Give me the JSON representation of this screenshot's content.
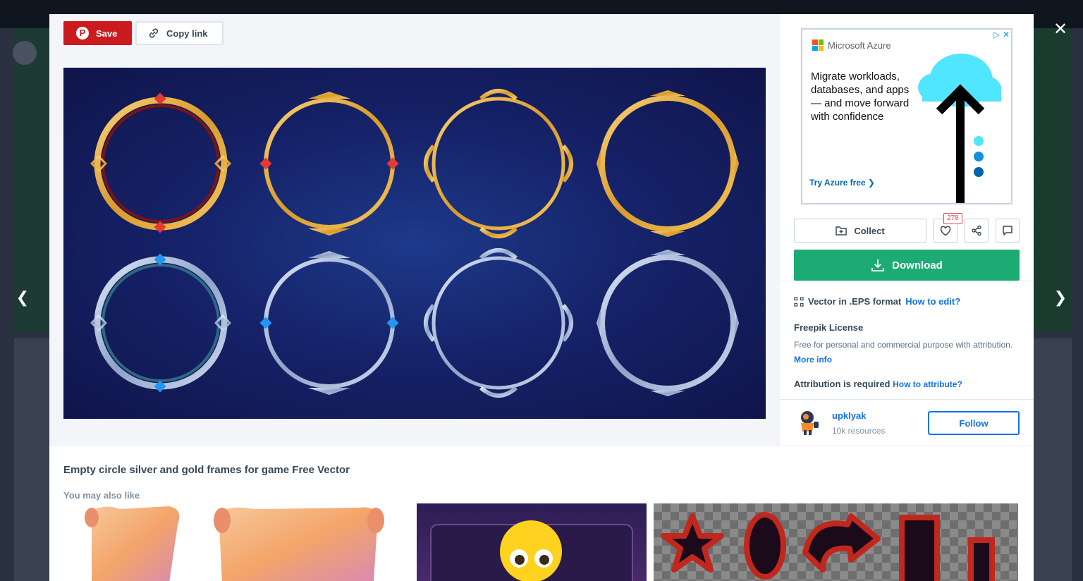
{
  "modal": {
    "save_label": "Save",
    "copy_label": "Copy link",
    "close_icon": "close-icon",
    "prev_icon": "chevron-left-icon",
    "next_icon": "chevron-right-icon"
  },
  "image": {
    "title": "Empty circle silver and gold frames for game Free Vector"
  },
  "ad": {
    "brand": "Microsoft Azure",
    "headline": "Migrate workloads, databases, and apps— and move forward with confidence",
    "cta": "Try Azure free ❯"
  },
  "actions": {
    "collect_label": "Collect",
    "like_count": "278",
    "download_label": "Download"
  },
  "info": {
    "format_label": "Vector in .EPS format",
    "how_to_edit": "How to edit?",
    "license_title": "Freepik License",
    "license_text": "Free for personal and commercial purpose with attribution.",
    "more_info": "More info",
    "attribution_label": "Attribution is required",
    "how_to_attribute": "How to attribute?"
  },
  "author": {
    "name": "upklyak",
    "resources": "10k resources",
    "follow_label": "Follow"
  },
  "related": {
    "title": "You may also like"
  },
  "colors": {
    "save_red": "#cb1b1f",
    "download_green": "#1dab74",
    "link_blue": "#1273eb",
    "gold": "#d9a23a",
    "silver": "#9fb2d6"
  }
}
